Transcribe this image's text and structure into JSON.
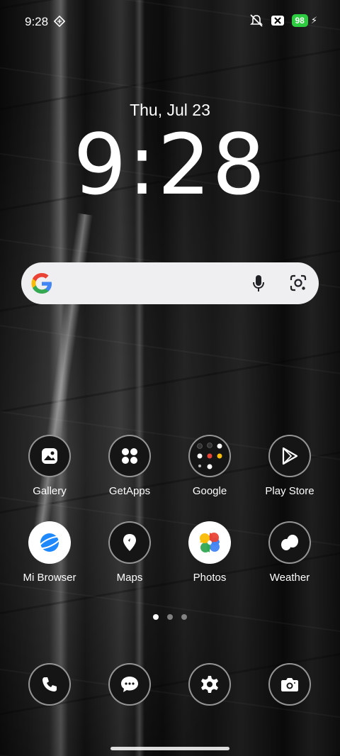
{
  "status_bar": {
    "time": "9:28",
    "battery": "98"
  },
  "lockscreen": {
    "date": "Thu, Jul 23",
    "clock": "9:28"
  },
  "search": {
    "icons": [
      "google-logo",
      "microphone",
      "google-lens"
    ]
  },
  "apps": [
    {
      "label": "Gallery",
      "icon": "gallery-icon"
    },
    {
      "label": "GetApps",
      "icon": "getapps-icon"
    },
    {
      "label": "Google",
      "icon": "google-folder-icon"
    },
    {
      "label": "Play Store",
      "icon": "play-store-icon"
    },
    {
      "label": "Mi Browser",
      "icon": "mi-browser-icon"
    },
    {
      "label": "Maps",
      "icon": "maps-icon"
    },
    {
      "label": "Photos",
      "icon": "photos-icon"
    },
    {
      "label": "Weather",
      "icon": "weather-icon"
    }
  ],
  "pager": {
    "pages": 3,
    "current": 1
  },
  "dock": [
    {
      "icon": "phone-icon"
    },
    {
      "icon": "messages-icon"
    },
    {
      "icon": "settings-icon"
    },
    {
      "icon": "camera-icon"
    }
  ],
  "colors": {
    "battery": "#2ecc40",
    "search_bg": "#efeff1"
  }
}
